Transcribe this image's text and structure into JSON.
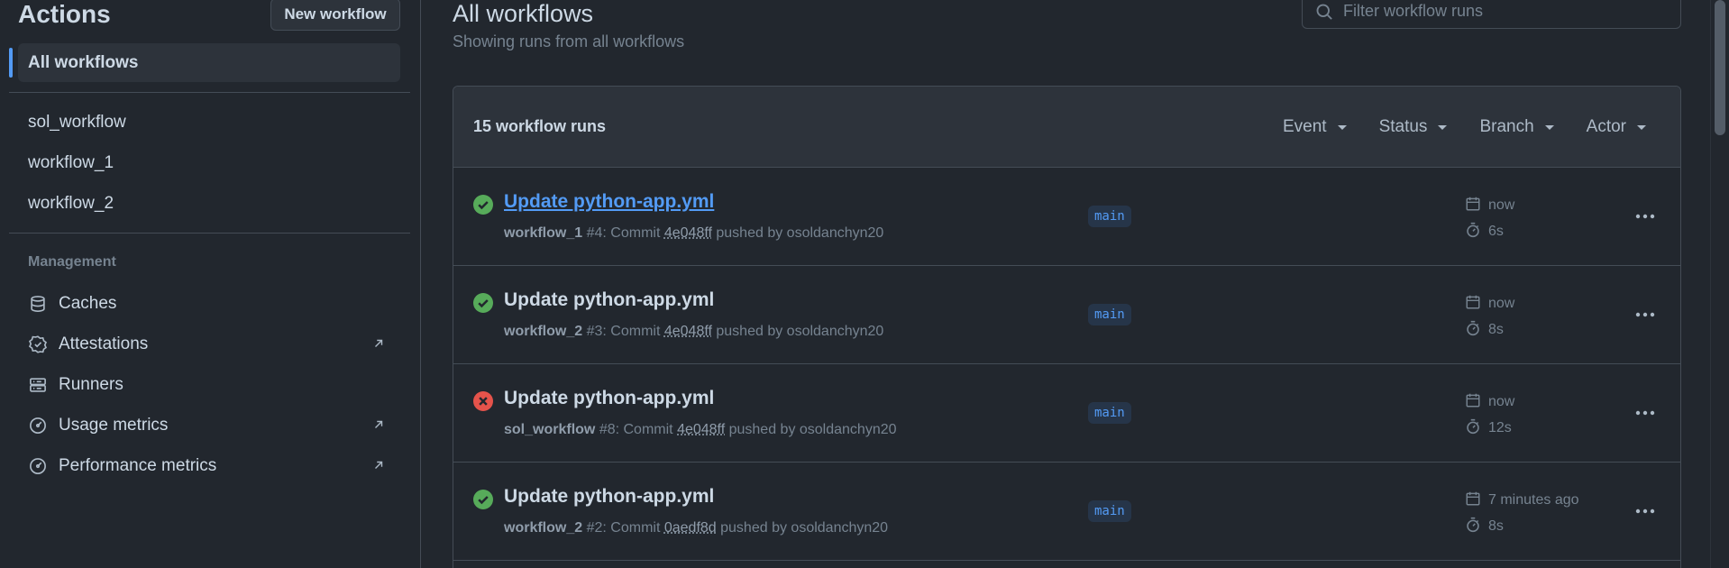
{
  "sidebar": {
    "title": "Actions",
    "new_workflow": "New workflow",
    "active_item": "All workflows",
    "workflows": [
      "sol_workflow",
      "workflow_1",
      "workflow_2"
    ],
    "management_heading": "Management",
    "management": [
      {
        "label": "Caches",
        "icon": "database-icon",
        "external": false
      },
      {
        "label": "Attestations",
        "icon": "verified-badge-icon",
        "external": true
      },
      {
        "label": "Runners",
        "icon": "server-icon",
        "external": false
      },
      {
        "label": "Usage metrics",
        "icon": "meter-icon",
        "external": true
      },
      {
        "label": "Performance metrics",
        "icon": "meter-icon",
        "external": true
      }
    ]
  },
  "main": {
    "title": "All workflows",
    "subtitle": "Showing runs from all workflows",
    "filter_placeholder": "Filter workflow runs",
    "count": "15 workflow runs",
    "filters": [
      "Event",
      "Status",
      "Branch",
      "Actor"
    ],
    "runs": [
      {
        "status": "success",
        "title": "Update python-app.yml",
        "workflow": "workflow_1",
        "number": "#4",
        "text_before": ": Commit ",
        "sha": "4e048ff",
        "text_after": " pushed by osoldanchyn20",
        "branch": "main",
        "when": "now",
        "duration": "6s"
      },
      {
        "status": "success",
        "title": "Update python-app.yml",
        "workflow": "workflow_2",
        "number": "#3",
        "text_before": ": Commit ",
        "sha": "4e048ff",
        "text_after": " pushed by osoldanchyn20",
        "branch": "main",
        "when": "now",
        "duration": "8s"
      },
      {
        "status": "failure",
        "title": "Update python-app.yml",
        "workflow": "sol_workflow",
        "number": "#8",
        "text_before": ": Commit ",
        "sha": "4e048ff",
        "text_after": " pushed by osoldanchyn20",
        "branch": "main",
        "when": "now",
        "duration": "12s"
      },
      {
        "status": "success",
        "title": "Update python-app.yml",
        "workflow": "workflow_2",
        "number": "#2",
        "text_before": ": Commit ",
        "sha": "0aedf8d",
        "text_after": " pushed by osoldanchyn20",
        "branch": "main",
        "when": "7 minutes ago",
        "duration": "8s"
      }
    ]
  },
  "colors": {
    "success": "#57ab5a",
    "failure": "#e5534b",
    "accent": "#539bf5"
  }
}
